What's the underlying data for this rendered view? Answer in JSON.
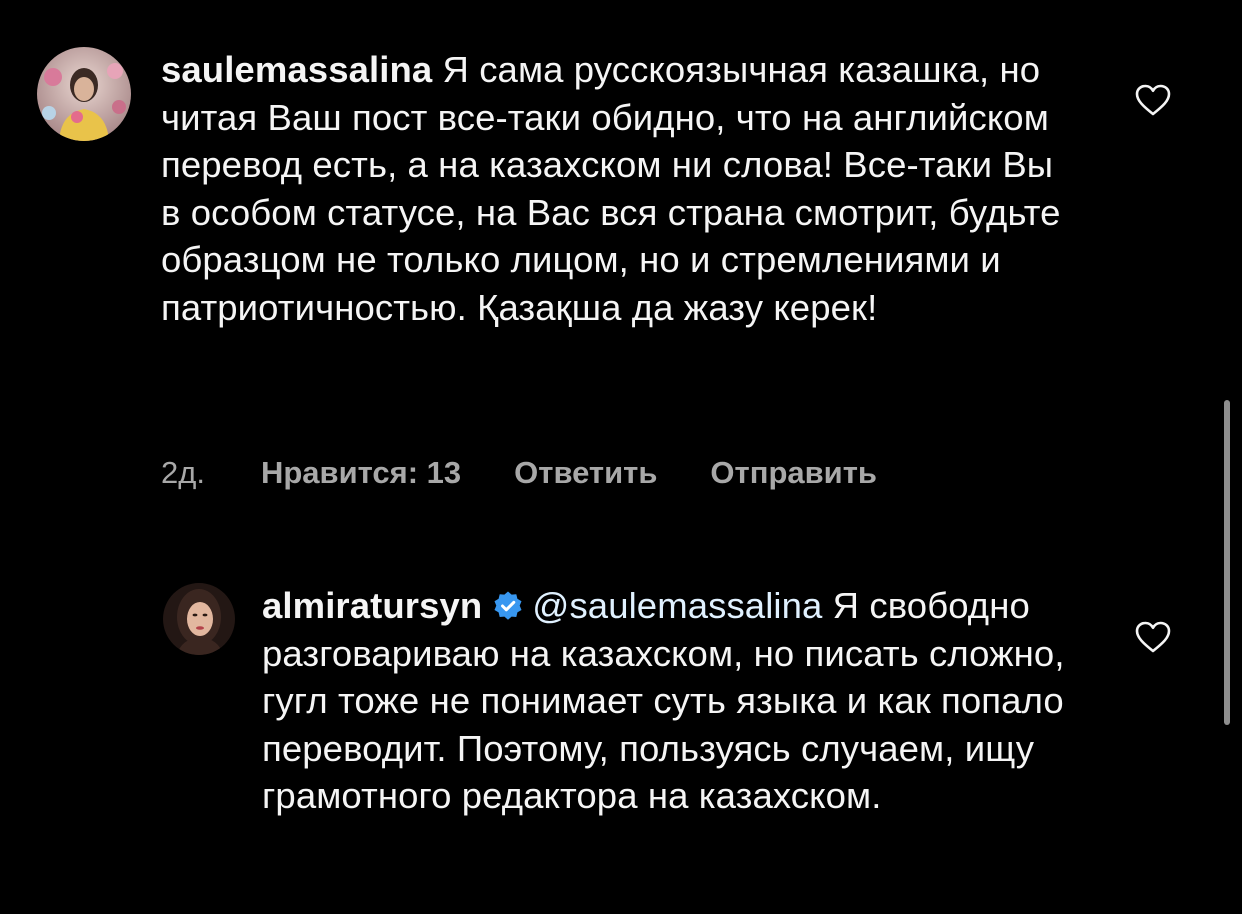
{
  "comments": [
    {
      "username": "saulemassalina",
      "text": " Я сама русскоязычная казашка, но читая Ваш пост все-таки обидно, что на английском перевод есть, а на казахском ни слова! Все-таки Вы в особом статусе, на Вас вся страна смотрит, будьте образцом не только лицом, но и стремлениями и патриотичностью. Қазақша да жазу керек!",
      "time": "2д.",
      "likes_label": "Нравится: 13",
      "reply_label": "Ответить",
      "send_label": "Отправить",
      "like_icon": "heart-outline-icon"
    },
    {
      "username": "almiratursyn",
      "verified": true,
      "mention": "@saulemassalina",
      "text": " Я свободно разговариваю на казахском, но писать сложно, гугл тоже не понимает суть языка и как попало переводит. Поэтому, пользуясь случаем, ищу грамотного редактора на казахском.",
      "like_icon": "heart-outline-icon"
    }
  ],
  "colors": {
    "background": "#000000",
    "text": "#f5f5f5",
    "secondary_text": "#a8a8a8",
    "mention": "#e0f1ff",
    "verified_badge": "#3897f0"
  }
}
